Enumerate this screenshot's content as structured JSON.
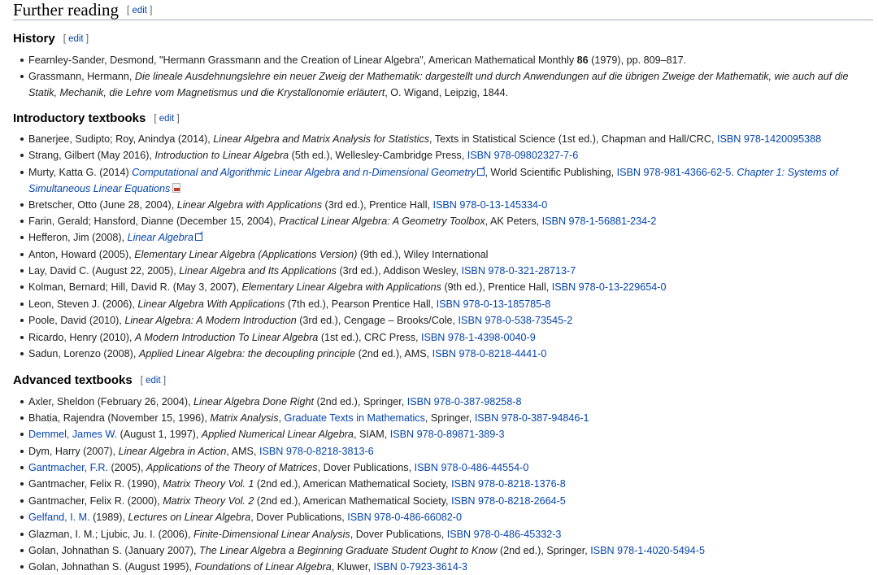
{
  "section": {
    "title": "Further reading",
    "edit": "edit"
  },
  "history": {
    "title": "History",
    "edit": "edit",
    "items": [
      {
        "a": "Fearnley-Sander, Desmond, \"Hermann Grassmann and the Creation of Linear Algebra\", American Mathematical Monthly ",
        "b": "86",
        "c": " (1979), pp. 809–817."
      },
      {
        "a": "Grassmann, Hermann, ",
        "i": "Die lineale Ausdehnungslehre ein neuer Zweig der Mathematik: dargestellt und durch Anwendungen auf die übrigen Zweige der Mathematik, wie auch auf die Statik, Mechanik, die Lehre vom Magnetismus und die Krystallonomie erläutert",
        "c": ", O. Wigand, Leipzig, 1844."
      }
    ]
  },
  "intro": {
    "title": "Introductory textbooks",
    "edit": "edit",
    "items": [
      {
        "a": "Banerjee, Sudipto; Roy, Anindya (2014), ",
        "i": "Linear Algebra and Matrix Analysis for Statistics",
        "c": ", Texts in Statistical Science (1st ed.), Chapman and Hall/CRC, ",
        "isbn": "ISBN 978-1420095388"
      },
      {
        "a": "Strang, Gilbert (May 2016), ",
        "i": "Introduction to Linear Algebra",
        "c": " (5th ed.), Wellesley-Cambridge Press, ",
        "isbn": "ISBN 978-09802327-7-6"
      },
      {
        "a": "Murty, Katta G. (2014) ",
        "link": "Computational and Algorithmic Linear Algebra and n-Dimensional Geometry",
        "c": ", World Scientific Publishing, ",
        "isbn": "ISBN 978-981-4366-62-5",
        "d": ". ",
        "link2": "Chapter 1: Systems of Simultaneous Linear Equations"
      },
      {
        "a": "Bretscher, Otto (June 28, 2004), ",
        "i": "Linear Algebra with Applications",
        "c": " (3rd ed.), Prentice Hall, ",
        "isbn": "ISBN 978-0-13-145334-0"
      },
      {
        "a": "Farin, Gerald; Hansford, Dianne (December 15, 2004), ",
        "i": "Practical Linear Algebra: A Geometry Toolbox",
        "c": ", AK Peters, ",
        "isbn": "ISBN 978-1-56881-234-2"
      },
      {
        "a": "Hefferon, Jim (2008), ",
        "link": "Linear Algebra"
      },
      {
        "a": "Anton, Howard (2005), ",
        "i": "Elementary Linear Algebra (Applications Version)",
        "c": " (9th ed.), Wiley International"
      },
      {
        "a": "Lay, David C. (August 22, 2005), ",
        "i": "Linear Algebra and Its Applications",
        "c": " (3rd ed.), Addison Wesley, ",
        "isbn": "ISBN 978-0-321-28713-7"
      },
      {
        "a": "Kolman, Bernard; Hill, David R. (May 3, 2007), ",
        "i": "Elementary Linear Algebra with Applications",
        "c": " (9th ed.), Prentice Hall, ",
        "isbn": "ISBN 978-0-13-229654-0"
      },
      {
        "a": "Leon, Steven J. (2006), ",
        "i": "Linear Algebra With Applications",
        "c": " (7th ed.), Pearson Prentice Hall, ",
        "isbn": "ISBN 978-0-13-185785-8"
      },
      {
        "a": "Poole, David (2010), ",
        "i": "Linear Algebra: A Modern Introduction",
        "c": " (3rd ed.), Cengage – Brooks/Cole, ",
        "isbn": "ISBN 978-0-538-73545-2"
      },
      {
        "a": "Ricardo, Henry (2010), ",
        "i": "A Modern Introduction To Linear Algebra",
        "c": " (1st ed.), CRC Press, ",
        "isbn": "ISBN 978-1-4398-0040-9"
      },
      {
        "a": "Sadun, Lorenzo (2008), ",
        "i": "Applied Linear Algebra: the decoupling principle",
        "c": " (2nd ed.), AMS, ",
        "isbn": "ISBN 978-0-8218-4441-0"
      }
    ]
  },
  "advanced": {
    "title": "Advanced textbooks",
    "edit": "edit",
    "items": [
      {
        "a": "Axler, Sheldon (February 26, 2004), ",
        "i": "Linear Algebra Done Right",
        "c": " (2nd ed.), Springer, ",
        "isbn": "ISBN 978-0-387-98258-8"
      },
      {
        "a": "Bhatia, Rajendra (November 15, 1996), ",
        "i": "Matrix Analysis",
        "c": ", ",
        "series": "Graduate Texts in Mathematics",
        "d": ", Springer, ",
        "isbn": "ISBN 978-0-387-94846-1"
      },
      {
        "author": "Demmel, James W.",
        "a": " (August 1, 1997), ",
        "i": "Applied Numerical Linear Algebra",
        "c": ", SIAM, ",
        "isbn": "ISBN 978-0-89871-389-3"
      },
      {
        "a": "Dym, Harry (2007), ",
        "i": "Linear Algebra in Action",
        "c": ", AMS, ",
        "isbn": "ISBN 978-0-8218-3813-6"
      },
      {
        "author": "Gantmacher, F.R.",
        "a": " (2005), ",
        "i": "Applications of the Theory of Matrices",
        "c": ", Dover Publications, ",
        "isbn": "ISBN 978-0-486-44554-0"
      },
      {
        "a": "Gantmacher, Felix R. (1990), ",
        "i": "Matrix Theory Vol. 1",
        "c": " (2nd ed.), American Mathematical Society, ",
        "isbn": "ISBN 978-0-8218-1376-8"
      },
      {
        "a": "Gantmacher, Felix R. (2000), ",
        "i": "Matrix Theory Vol. 2",
        "c": " (2nd ed.), American Mathematical Society, ",
        "isbn": "ISBN 978-0-8218-2664-5"
      },
      {
        "author": "Gelfand, I. M.",
        "a": " (1989), ",
        "i": "Lectures on Linear Algebra",
        "c": ", Dover Publications, ",
        "isbn": "ISBN 978-0-486-66082-0"
      },
      {
        "a": "Glazman, I. M.; Ljubic, Ju. I. (2006), ",
        "i": "Finite-Dimensional Linear Analysis",
        "c": ", Dover Publications, ",
        "isbn": "ISBN 978-0-486-45332-3"
      },
      {
        "a": "Golan, Johnathan S. (January 2007), ",
        "i": "The Linear Algebra a Beginning Graduate Student Ought to Know",
        "c": " (2nd ed.), Springer, ",
        "isbn": "ISBN 978-1-4020-5494-5"
      },
      {
        "a": "Golan, Johnathan S. (August 1995), ",
        "i": "Foundations of Linear Algebra",
        "c": ", Kluwer, ",
        "isbn": "ISBN 0-7923-3614-3"
      }
    ]
  }
}
